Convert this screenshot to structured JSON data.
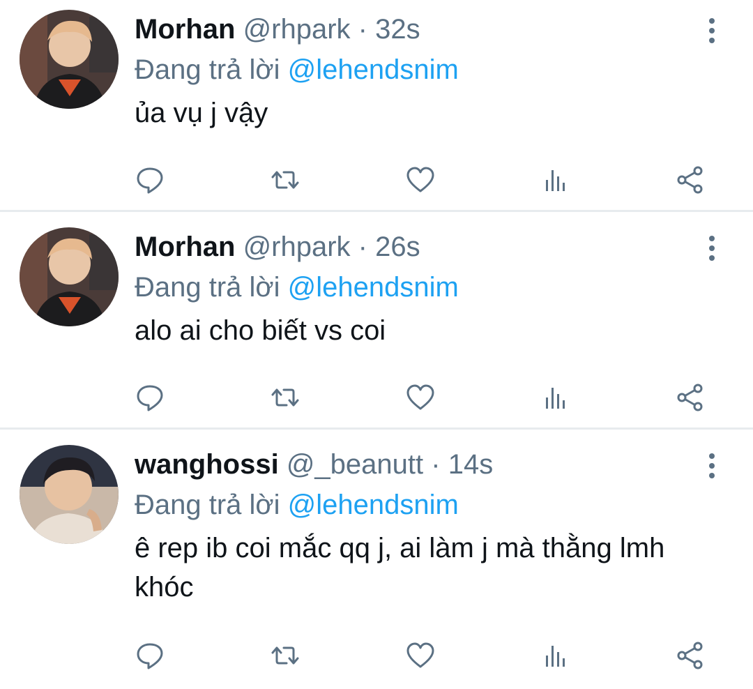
{
  "colors": {
    "text": "#0f1419",
    "secondary": "#5b7083",
    "mention": "#1da1f2",
    "divider": "#e7ebee"
  },
  "tweets": [
    {
      "name": "Morhan",
      "handle": "@rhpark",
      "separator": "·",
      "time": "32s",
      "reply_prefix": "Đang trả lời",
      "reply_to": "@lehendsnim",
      "text": "ủa vụ j vậy",
      "avatar": "avatar-photo"
    },
    {
      "name": "Morhan",
      "handle": "@rhpark",
      "separator": "·",
      "time": "26s",
      "reply_prefix": "Đang trả lời",
      "reply_to": "@lehendsnim",
      "text": "alo ai cho biết vs coi",
      "avatar": "avatar-photo"
    },
    {
      "name": "wanghossi",
      "handle": "@_beanutt",
      "separator": "·",
      "time": "14s",
      "reply_prefix": "Đang trả lời",
      "reply_to": "@lehendsnim",
      "text": "ê rep ib coi mắc qq j, ai làm j mà thằng lmh khóc",
      "avatar": "avatar-photo"
    }
  ],
  "action_icons": [
    "reply-icon",
    "retweet-icon",
    "like-icon",
    "analytics-icon",
    "share-icon"
  ]
}
